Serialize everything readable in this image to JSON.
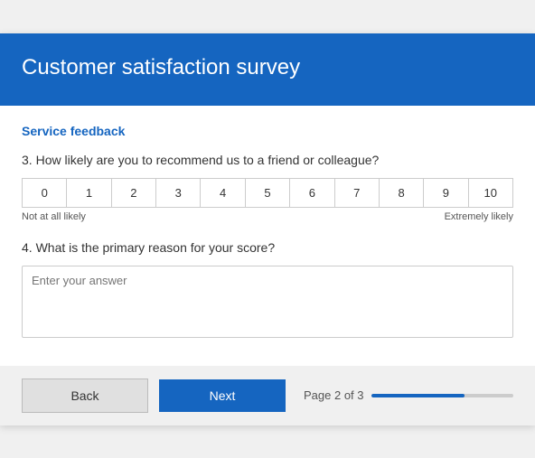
{
  "header": {
    "title": "Customer satisfaction survey"
  },
  "section": {
    "label": "Service feedback"
  },
  "questions": {
    "q3": {
      "number": "3.",
      "text": "How likely are you to recommend us to a friend or colleague?",
      "scale": [
        0,
        1,
        2,
        3,
        4,
        5,
        6,
        7,
        8,
        9,
        10
      ],
      "label_low": "Not at all likely",
      "label_high": "Extremely likely"
    },
    "q4": {
      "number": "4.",
      "text": "What is the primary reason for your score?",
      "placeholder": "Enter your answer"
    }
  },
  "footer": {
    "back_label": "Back",
    "next_label": "Next",
    "page_label": "Page 2 of 3",
    "progress_percent": 66
  }
}
